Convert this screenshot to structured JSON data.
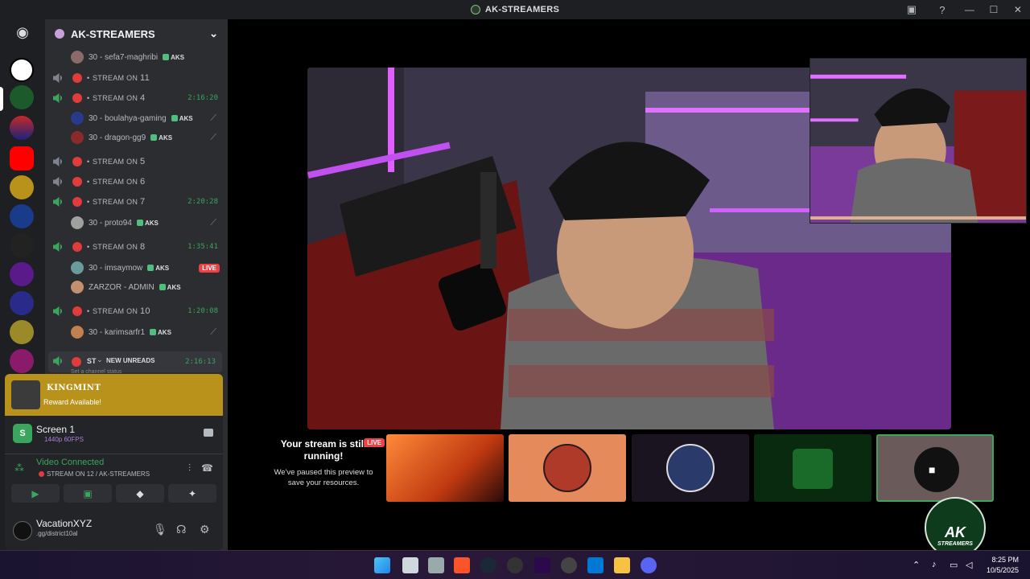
{
  "window": {
    "title": "AK-STREAMERS"
  },
  "server": {
    "name": "AK-STREAMERS"
  },
  "channels": [
    {
      "type": "user",
      "name": "30 - sefa7-maghribi",
      "tag": "AKS"
    },
    {
      "type": "channel",
      "name": "STREAM ON",
      "num": "11",
      "timer": ""
    },
    {
      "type": "channel",
      "name": "STREAM ON",
      "num": "4",
      "timer": "2:16:20"
    },
    {
      "type": "user",
      "name": "30 - boulahya-gaming",
      "tag": "AKS"
    },
    {
      "type": "user",
      "name": "30 - dragon-gg9",
      "tag": "AKS"
    },
    {
      "type": "channel",
      "name": "STREAM ON",
      "num": "5",
      "timer": ""
    },
    {
      "type": "channel",
      "name": "STREAM ON",
      "num": "6",
      "timer": ""
    },
    {
      "type": "channel",
      "name": "STREAM ON",
      "num": "7",
      "timer": "2:20:28"
    },
    {
      "type": "user",
      "name": "30 - proto94",
      "tag": "AKS"
    },
    {
      "type": "channel",
      "name": "STREAM ON",
      "num": "8",
      "timer": "1:35:41"
    },
    {
      "type": "user",
      "name": "30 - imsaymow",
      "tag": "AKS",
      "live": "LIVE"
    },
    {
      "type": "user",
      "name": "ZARZOR - ADMIN",
      "tag": "AKS"
    },
    {
      "type": "channel",
      "name": "STREAM ON",
      "num": "10",
      "timer": "1:20:08"
    },
    {
      "type": "user",
      "name": "30 - karimsarfr1",
      "tag": "AKS"
    }
  ],
  "unreads": {
    "label": "NEW UNREADS",
    "prefix": "ST",
    "timer": "2:16:13",
    "status_hint": "Set a channel status"
  },
  "promo": {
    "title": "KINGMINT",
    "subtitle": "Reward Available!"
  },
  "screen": {
    "name": "Screen 1",
    "quality": "1440p 60FPS"
  },
  "voice": {
    "status": "Video Connected",
    "channel": "STREAM ON 12 / AK-STREAMERS"
  },
  "me": {
    "name": "VacationXYZ",
    "status": ".gg/district10al"
  },
  "preview": {
    "title": "Your stream is still running!",
    "subtitle": "We've paused this preview to save your resources.",
    "live": "LIVE"
  },
  "badge": {
    "title": "AK",
    "subtitle": "STREAMERS"
  },
  "taskbar": {
    "time": "8:25 PM",
    "date": "10/5/2025"
  },
  "colors": {
    "accent_green": "#3ba55d",
    "live_red": "#ed4245",
    "promo_gold": "#b8921a"
  }
}
